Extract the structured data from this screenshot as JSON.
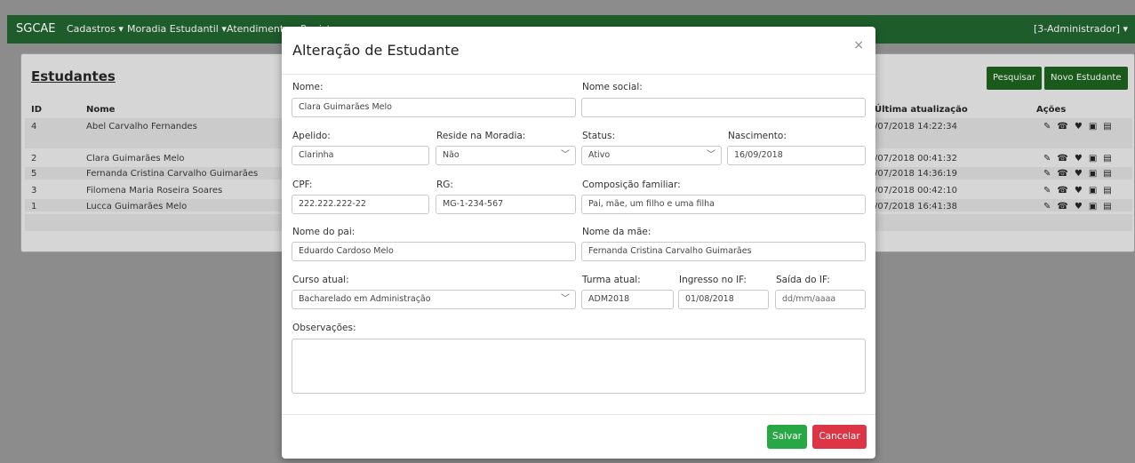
{
  "navbar": {
    "brand": "SGCAE",
    "menus": [
      "Cadastros ▾",
      "Moradia Estudantil ▾",
      "Atendimentos ▾",
      "Registros ▾"
    ],
    "user": "[3-Administrador] ▾"
  },
  "list": {
    "title": "Estudantes",
    "search_button": "Pesquisar",
    "new_button": "Novo Estudante",
    "columns": {
      "id": "ID",
      "nome": "Nome",
      "atualizacao": "Última atualização",
      "acoes": "Ações"
    },
    "rows": [
      {
        "id": "4",
        "nome": "Abel Carvalho Fernandes",
        "atualizacao": "/07/2018 14:22:34"
      },
      {
        "id": "2",
        "nome": "Clara Guimarães Melo",
        "atualizacao": "/07/2018 00:41:32"
      },
      {
        "id": "5",
        "nome": "Fernanda Cristina Carvalho Guimarães",
        "atualizacao": "/07/2018 14:36:19"
      },
      {
        "id": "3",
        "nome": "Filomena Maria Roseira Soares",
        "atualizacao": "/07/2018 00:42:10"
      },
      {
        "id": "1",
        "nome": "Lucca Guimarães Melo",
        "atualizacao": "/07/2018 16:41:38"
      }
    ],
    "action_icons": [
      "✎",
      "☎",
      "♥",
      "▣",
      "▤"
    ]
  },
  "modal": {
    "title": "Alteração de Estudante",
    "close": "×",
    "labels": {
      "nome": "Nome:",
      "nome_social": "Nome social:",
      "apelido": "Apelido:",
      "reside": "Reside na Moradia:",
      "status": "Status:",
      "nascimento": "Nascimento:",
      "cpf": "CPF:",
      "rg": "RG:",
      "composicao": "Composição familiar:",
      "pai": "Nome do pai:",
      "mae": "Nome da mãe:",
      "curso": "Curso atual:",
      "turma": "Turma atual:",
      "ingresso": "Ingresso no IF:",
      "saida": "Saída do IF:",
      "observacoes": "Observações:"
    },
    "values": {
      "nome": "Clara Guimarães Melo",
      "nome_social": "",
      "apelido": "Clarinha",
      "reside": "Não",
      "status": "Ativo",
      "nascimento": "16/09/2018",
      "cpf": "222.222.222-22",
      "rg": "MG-1-234-567",
      "composicao": "Pai, mãe, um filho e uma filha",
      "pai": "Eduardo Cardoso Melo",
      "mae": "Fernanda Cristina Carvalho Guimarães",
      "curso": "Bacharelado em Administração",
      "turma": "ADM2018",
      "ingresso": "01/08/2018",
      "observacoes": ""
    },
    "placeholders": {
      "saida": "dd/mm/aaaa"
    },
    "save_button": "Salvar",
    "cancel_button": "Cancelar"
  }
}
